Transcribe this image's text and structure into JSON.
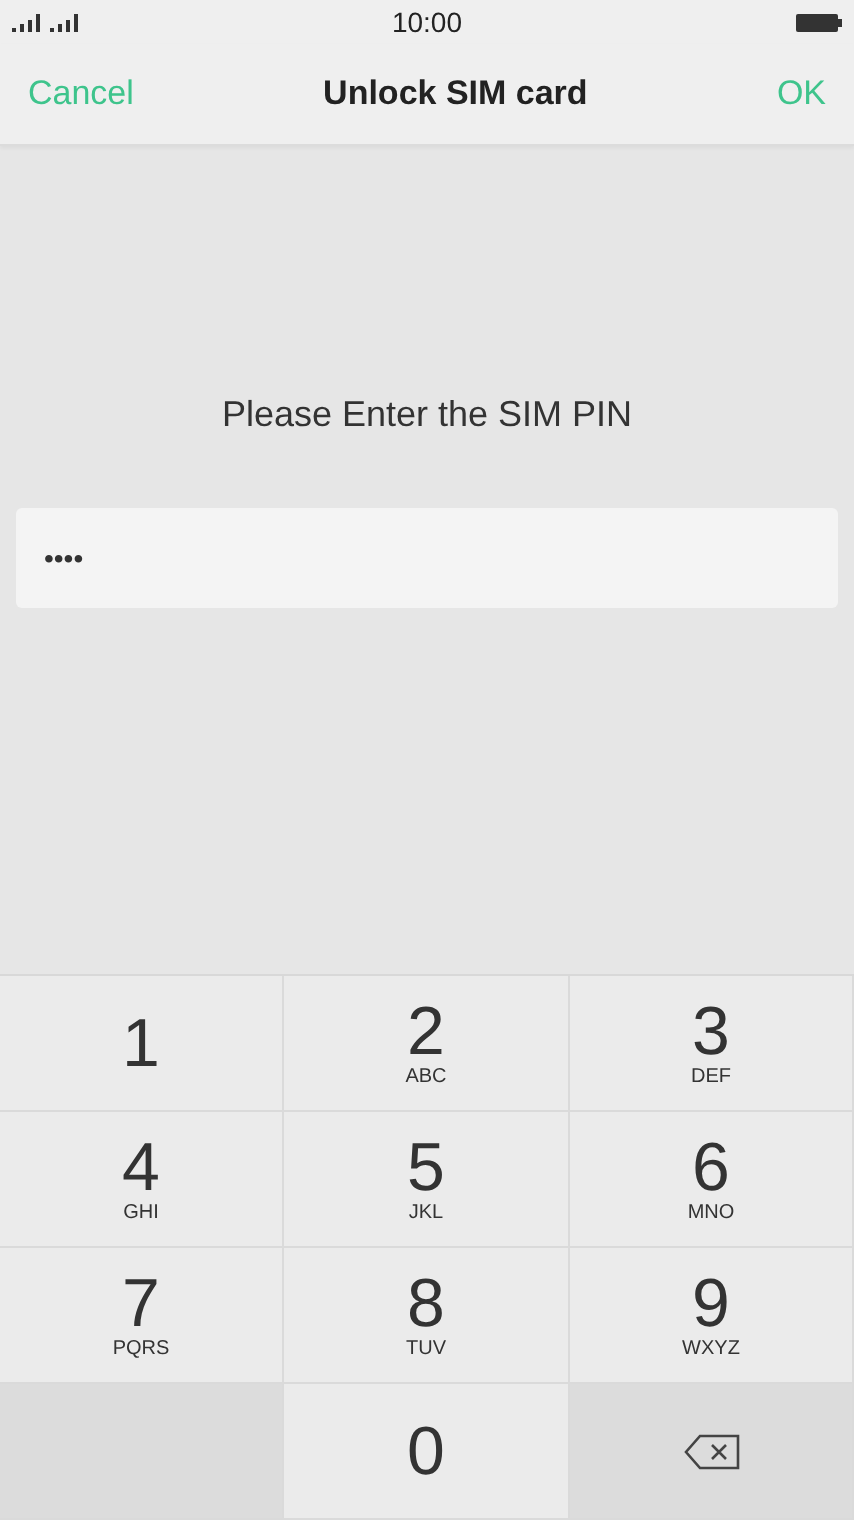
{
  "status_bar": {
    "time": "10:00"
  },
  "header": {
    "cancel": "Cancel",
    "title": "Unlock SIM card",
    "ok": "OK"
  },
  "prompt": "Please Enter the SIM PIN",
  "pin_field": {
    "value": "••••"
  },
  "keypad": [
    {
      "kind": "digit",
      "digit": "1"
    },
    {
      "kind": "digit",
      "digit": "2",
      "letters": "ABC"
    },
    {
      "kind": "digit",
      "digit": "3",
      "letters": "DEF"
    },
    {
      "kind": "digit",
      "digit": "4",
      "letters": "GHI"
    },
    {
      "kind": "digit",
      "digit": "5",
      "letters": "JKL"
    },
    {
      "kind": "digit",
      "digit": "6",
      "letters": "MNO"
    },
    {
      "kind": "digit",
      "digit": "7",
      "letters": "PQRS"
    },
    {
      "kind": "digit",
      "digit": "8",
      "letters": "TUV"
    },
    {
      "kind": "digit",
      "digit": "9",
      "letters": "WXYZ"
    },
    {
      "kind": "blank"
    },
    {
      "kind": "digit",
      "digit": "0"
    },
    {
      "kind": "backspace"
    }
  ]
}
